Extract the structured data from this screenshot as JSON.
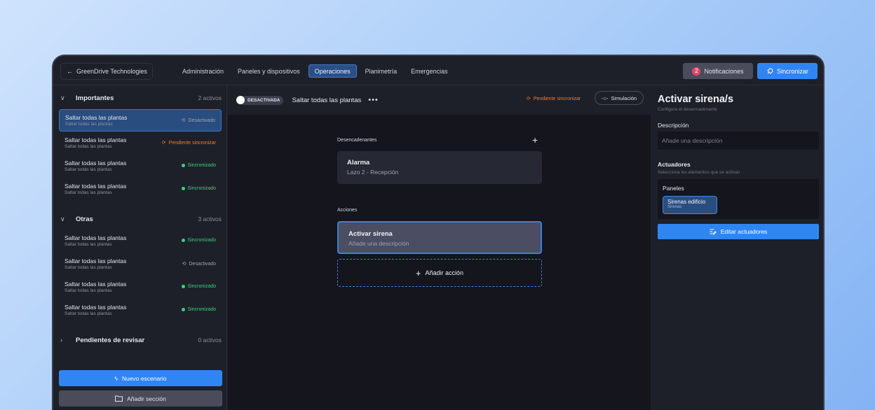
{
  "topbar": {
    "company": "GreenDrive Technologies",
    "tabs": [
      "Administración",
      "Paneles y dispositivos",
      "Operaciones",
      "Planimetría",
      "Emergencias"
    ],
    "active_tab": "Operaciones",
    "notifications_label": "Notificaciones",
    "notifications_count": "2",
    "sync_label": "Sincronizar"
  },
  "sidebar": {
    "sections": [
      {
        "title": "Importantes",
        "count": "2 activos",
        "items": [
          {
            "name": "Saltar todas las plantas",
            "sub": "Saltar todas las plantas",
            "status": "Desactivado",
            "kind": "gray"
          },
          {
            "name": "Saltar todas las plantas",
            "sub": "Saltar todas las plantas",
            "status": "Pendiente sincronizar",
            "kind": "orange"
          },
          {
            "name": "Saltar todas las plantas",
            "sub": "Saltar todas las plantas",
            "status": "Sincronizado",
            "kind": "green"
          },
          {
            "name": "Saltar todas las plantas",
            "sub": "Saltar todas las plantas",
            "status": "Sincronizado",
            "kind": "green"
          }
        ]
      },
      {
        "title": "Otras",
        "count": "3 activos",
        "items": [
          {
            "name": "Saltar todas las plantas",
            "sub": "Saltar todas las plantas",
            "status": "Sincronizado",
            "kind": "green"
          },
          {
            "name": "Saltar todas las plantas",
            "sub": "Saltar todas las plantas",
            "status": "Desactivado",
            "kind": "gray"
          },
          {
            "name": "Saltar todas las plantas",
            "sub": "Saltar todas las plantas",
            "status": "Sincronizado",
            "kind": "green"
          },
          {
            "name": "Saltar todas las plantas",
            "sub": "Saltar todas las plantas",
            "status": "Sincronizado",
            "kind": "green"
          }
        ]
      },
      {
        "title": "Pendientes de revisar",
        "count": "0 activos",
        "items": []
      }
    ],
    "new_scenario_label": "Nuevo escenario",
    "add_section_label": "Añadir sección"
  },
  "center": {
    "state_pill": "DESACTIVADA",
    "scenario_title": "Saltar todas las plantas",
    "more": "•••",
    "pending_label": "Pendiente sincronizar",
    "simulation_label": "Simulación",
    "triggers_label": "Desencadenantes",
    "trigger": {
      "title": "Alarma",
      "sub": "Lazo 2 - Recepción"
    },
    "actions_label": "Acciones",
    "action": {
      "title": "Activar sirena",
      "sub": "Añade una descripción"
    },
    "add_action_label": "Añadir acción"
  },
  "right": {
    "title": "Activar sirena/s",
    "subtitle": "Configura el desencadenante",
    "description_label": "Descripción",
    "description_placeholder": "Añade una descripción",
    "actuators_label": "Actuadores",
    "actuators_sub": "Selecciona los elementos que se activan",
    "panels_label": "Paneles",
    "chip_title": "Sirenas edificio",
    "chip_sub": "Sirenas",
    "edit_label": "Editar actuadores"
  },
  "colors": {
    "accent": "#2f86f3",
    "green": "#3ad07f",
    "orange": "#f07d31",
    "badge": "#e2466a"
  }
}
